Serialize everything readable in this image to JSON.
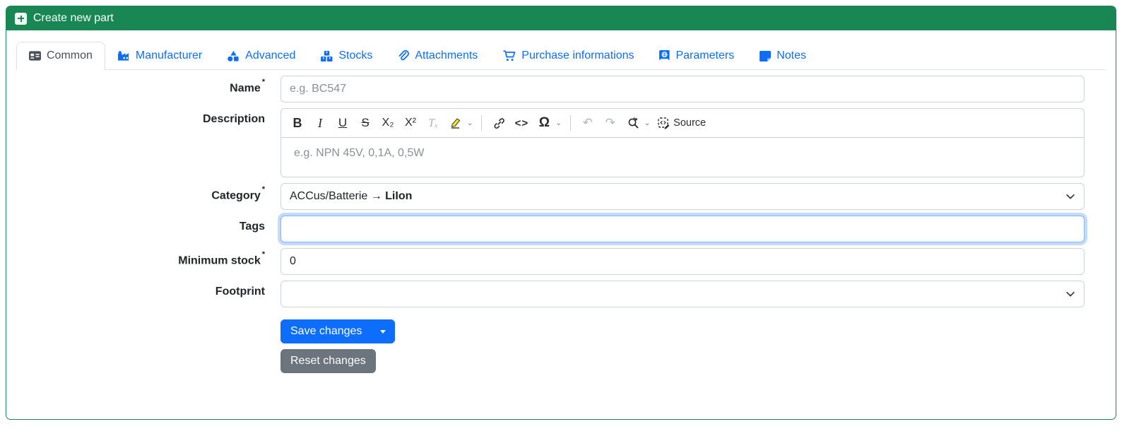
{
  "window": {
    "title": "Create new part"
  },
  "tabs": [
    {
      "label": "Common"
    },
    {
      "label": "Manufacturer"
    },
    {
      "label": "Advanced"
    },
    {
      "label": "Stocks"
    },
    {
      "label": "Attachments"
    },
    {
      "label": "Purchase informations"
    },
    {
      "label": "Parameters"
    },
    {
      "label": "Notes"
    }
  ],
  "form": {
    "name": {
      "label": "Name",
      "required": "*",
      "placeholder": "e.g. BC547",
      "value": ""
    },
    "description": {
      "label": "Description",
      "placeholder": "e.g. NPN 45V, 0,1A, 0,5W",
      "value": ""
    },
    "category": {
      "label": "Category",
      "required": "*",
      "value_prefix": "ACCus/Batterie → ",
      "value_bold": "LiIon"
    },
    "tags": {
      "label": "Tags",
      "value": "",
      "state": "focused"
    },
    "minimum_stock": {
      "label": "Minimum stock",
      "required": "*",
      "value": "0"
    },
    "footprint": {
      "label": "Footprint",
      "value": ""
    }
  },
  "editor_toolbar": {
    "bold": "B",
    "italic": "I",
    "underline": "U",
    "strikethrough": "S",
    "subscript": "X₂",
    "superscript": "X²",
    "remove_format": "Tₓ",
    "code": "<>",
    "special_characters": "Ω",
    "undo": "↶",
    "redo": "↷",
    "source_label": "Source"
  },
  "buttons": {
    "save": "Save changes",
    "reset": "Reset changes"
  },
  "colors": {
    "header_green": "#198754",
    "primary_blue": "#0d6efd",
    "secondary_gray": "#6c757d",
    "focus_ring": "#86b7fe",
    "border_gray": "#ced4da",
    "tab_active_text": "#495057",
    "placeholder_gray": "#8a9097",
    "highlighter_yellow": "#f8e71c"
  }
}
